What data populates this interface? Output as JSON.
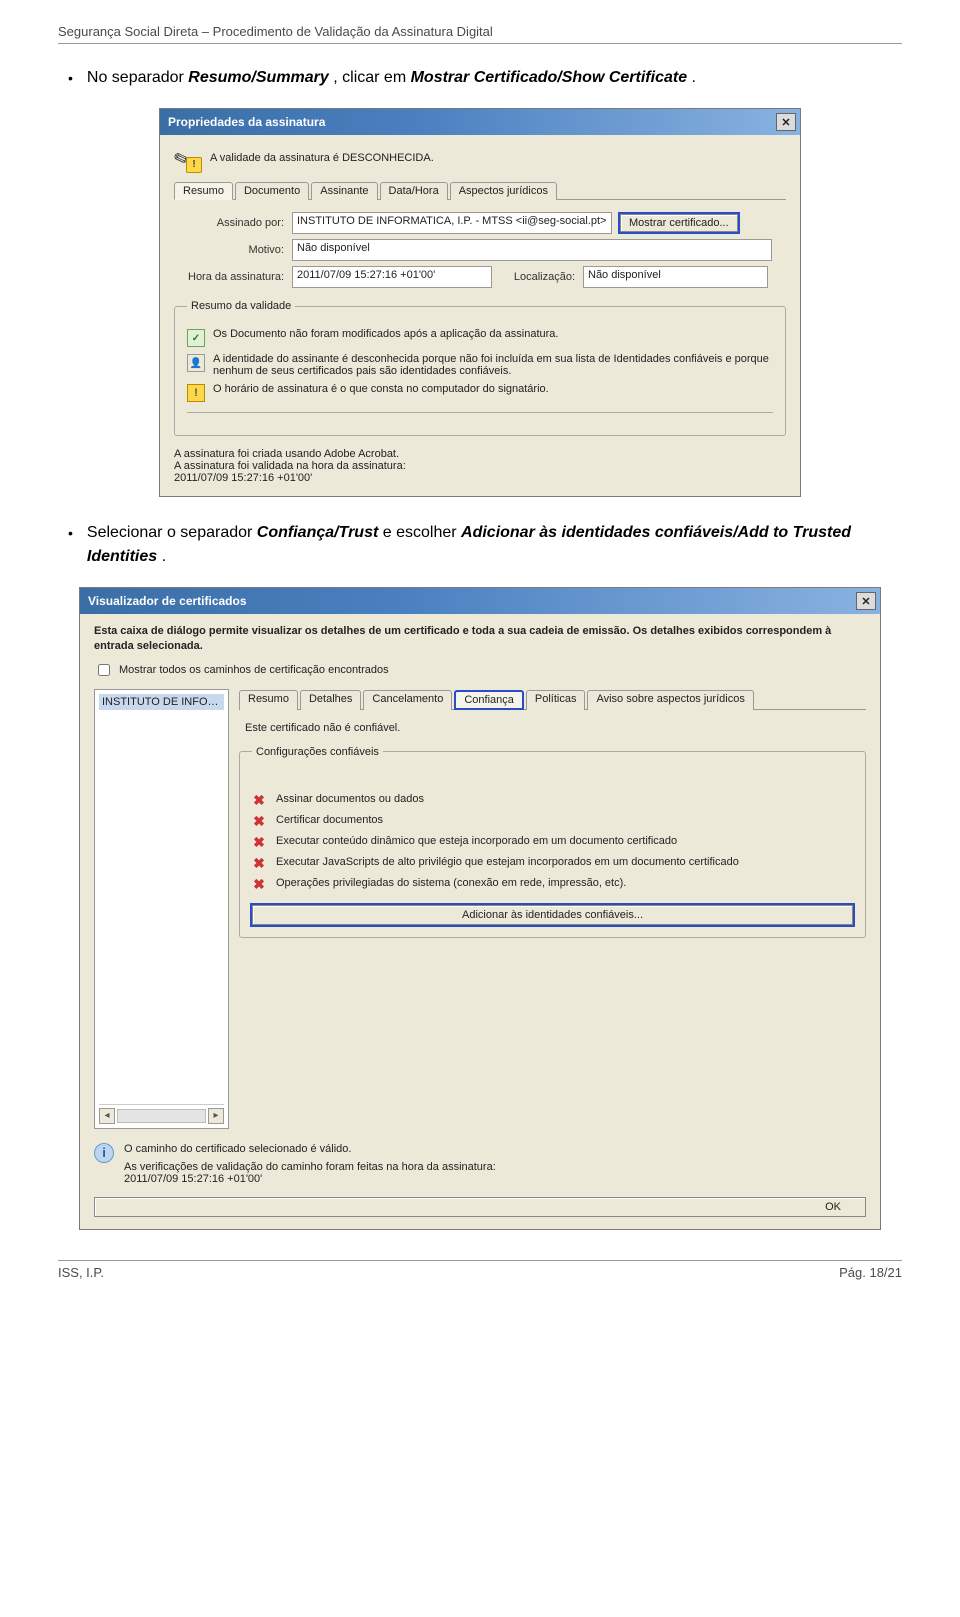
{
  "doc": {
    "header": "Segurança Social Direta – Procedimento de Validação da Assinatura Digital",
    "footer_left": "ISS, I.P.",
    "footer_right": "Pág. 18/21"
  },
  "bullet1": {
    "pre": "No separador ",
    "b1": "Resumo/Summary",
    "mid": ", clicar em ",
    "b2": "Mostrar Certificado/Show Certificate",
    "end": "."
  },
  "bullet2": {
    "pre": "Selecionar o separador ",
    "b1": "Confiança/Trust",
    "mid": " e escolher ",
    "b2": "Adicionar às identidades confiáveis/Add to Trusted Identities",
    "end": "."
  },
  "sig": {
    "title": "Propriedades da assinatura",
    "status": "A validade da assinatura é DESCONHECIDA.",
    "tabs": [
      "Resumo",
      "Documento",
      "Assinante",
      "Data/Hora",
      "Aspectos jurídicos"
    ],
    "lbl_signed": "Assinado por:",
    "val_signed": "INSTITUTO DE INFORMATICA, I.P. - MTSS <ii@seg-social.pt>",
    "btn_show": "Mostrar certificado...",
    "lbl_reason": "Motivo:",
    "val_reason": "Não disponível",
    "lbl_time": "Hora da assinatura:",
    "val_time": "2011/07/09 15:27:16 +01'00'",
    "lbl_loc": "Localização:",
    "val_loc": "Não disponível",
    "fs_title": "Resumo da validade",
    "v1": "Os Documento não foram modificados após a aplicação da assinatura.",
    "v2": "A identidade do assinante é desconhecida porque não foi incluída em sua lista de Identidades confiáveis e porque nenhum de seus certificados pais são identidades confiáveis.",
    "v3": "O horário de assinatura é o que consta no computador do signatário.",
    "bottom1": "A assinatura foi criada usando Adobe Acrobat.",
    "bottom2": "A assinatura foi validada na hora da assinatura:",
    "bottom3": "2011/07/09 15:27:16 +01'00'"
  },
  "cert": {
    "title": "Visualizador de certificados",
    "intro": "Esta caixa de diálogo permite visualizar os detalhes de um certificado e toda a sua cadeia de emissão. Os detalhes exibidos correspondem à entrada selecionada.",
    "cb": "Mostrar todos os caminhos de certificação encontrados",
    "listitem": "INSTITUTO DE INFORMATIC",
    "tabs": [
      "Resumo",
      "Detalhes",
      "Cancelamento",
      "Confiança",
      "Políticas",
      "Aviso sobre aspectos jurídicos"
    ],
    "notice": "Este certificado não é confiável.",
    "fs_title": "Configurações confiáveis",
    "t1": "Assinar documentos ou dados",
    "t2": "Certificar documentos",
    "t3": "Executar conteúdo dinâmico que esteja incorporado em um documento certificado",
    "t4": "Executar JavaScripts de alto privilégio que estejam incorporados em um documento certificado",
    "t5": "Operações privilegiadas do sistema (conexão em rede, impressão, etc).",
    "btn_add": "Adicionar às identidades confiáveis...",
    "info1": "O caminho do certificado selecionado é válido.",
    "info2a": "As verificações de validação do caminho foram feitas na hora da assinatura:",
    "info2b": "2011/07/09 15:27:16 +01'00'",
    "ok": "OK"
  }
}
